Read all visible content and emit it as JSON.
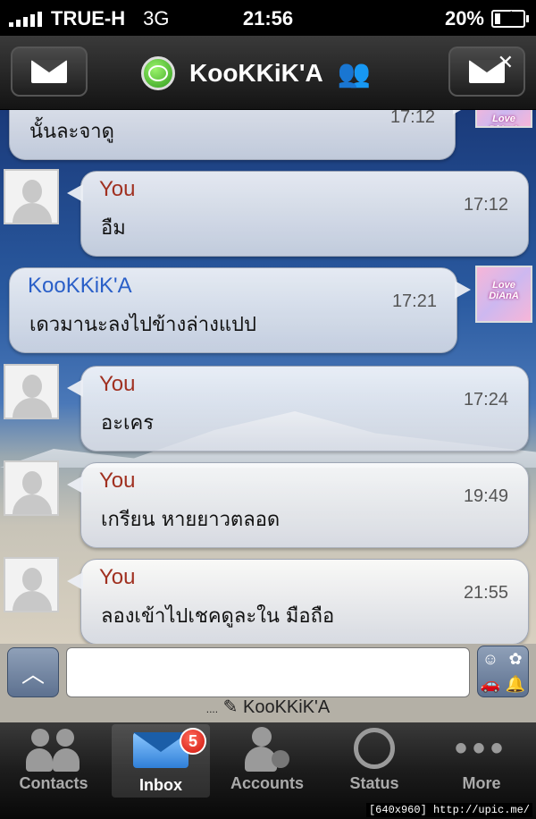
{
  "status_bar": {
    "carrier": "TRUE-H",
    "network": "3G",
    "time": "21:56",
    "battery": "20%",
    "battery_level": 0.2
  },
  "nav": {
    "title": "KooKKiK'A",
    "left_icon": "envelope-icon",
    "right_icon": "envelope-close-icon",
    "group_icon": "group-icon",
    "status_color": "#3fbf25"
  },
  "messages": [
    {
      "sender": "",
      "time": "17:12",
      "text": "นั้นละจาดู",
      "side": "them"
    },
    {
      "sender": "You",
      "time": "17:12",
      "text": "อืม",
      "side": "me"
    },
    {
      "sender": "KooKKiK'A",
      "time": "17:21",
      "text": "เดวมานะลงไปข้างล่างแปป",
      "side": "them"
    },
    {
      "sender": "You",
      "time": "17:24",
      "text": "อะเคร",
      "side": "me"
    },
    {
      "sender": "You",
      "time": "19:49",
      "text": "เกรียน หายยาวตลอด",
      "side": "me"
    },
    {
      "sender": "You",
      "time": "21:55",
      "text": "ลองเข้าไปเชคดูละใน มือถือ",
      "side": "me"
    }
  ],
  "avatar_text": "Love DiAnA",
  "input": {
    "value": "",
    "placeholder": "",
    "typing": "KooKKiK'A",
    "typing_dots": "...."
  },
  "tabs": [
    {
      "label": "Contacts",
      "icon": "contacts-icon"
    },
    {
      "label": "Inbox",
      "icon": "inbox-icon",
      "badge": "5",
      "active": true
    },
    {
      "label": "Accounts",
      "icon": "accounts-icon"
    },
    {
      "label": "Status",
      "icon": "status-icon"
    },
    {
      "label": "More",
      "icon": "more-icon"
    }
  ],
  "footer_note": "[640x960] http://upic.me/"
}
